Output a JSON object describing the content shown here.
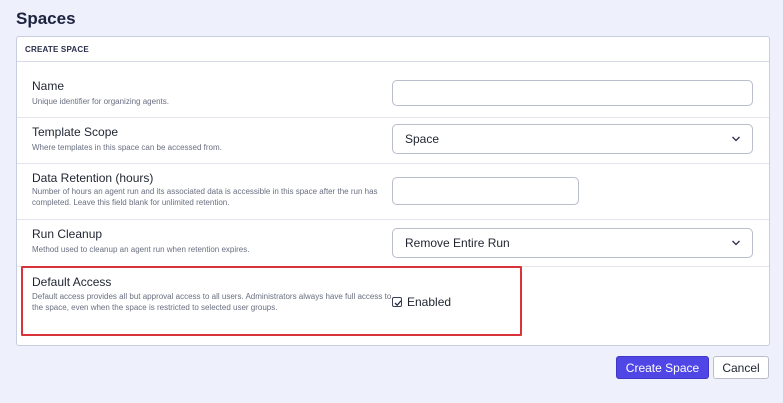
{
  "page": {
    "title": "Spaces"
  },
  "card": {
    "header": "CREATE SPACE"
  },
  "fields": {
    "name": {
      "label": "Name",
      "description": "Unique identifier for organizing agents.",
      "value": ""
    },
    "template_scope": {
      "label": "Template Scope",
      "description": "Where templates in this space can be accessed from.",
      "selected": "Space"
    },
    "data_retention": {
      "label": "Data Retention (hours)",
      "description": "Number of hours an agent run and its associated data is accessible in this space after the run has completed. Leave this field blank for unlimited retention.",
      "value": ""
    },
    "run_cleanup": {
      "label": "Run Cleanup",
      "description": "Method used to cleanup an agent run when retention expires.",
      "selected": "Remove Entire Run"
    },
    "default_access": {
      "label": "Default Access",
      "description": "Default access provides all but approval access to all users. Administrators always have full access to the space, even when the space is restricted to selected user groups.",
      "checkbox_label": "Enabled",
      "checked": true
    }
  },
  "buttons": {
    "create": "Create Space",
    "cancel": "Cancel"
  },
  "colors": {
    "primary": "#4f46e5",
    "highlight": "#d9343a",
    "background": "#eef0fb"
  }
}
